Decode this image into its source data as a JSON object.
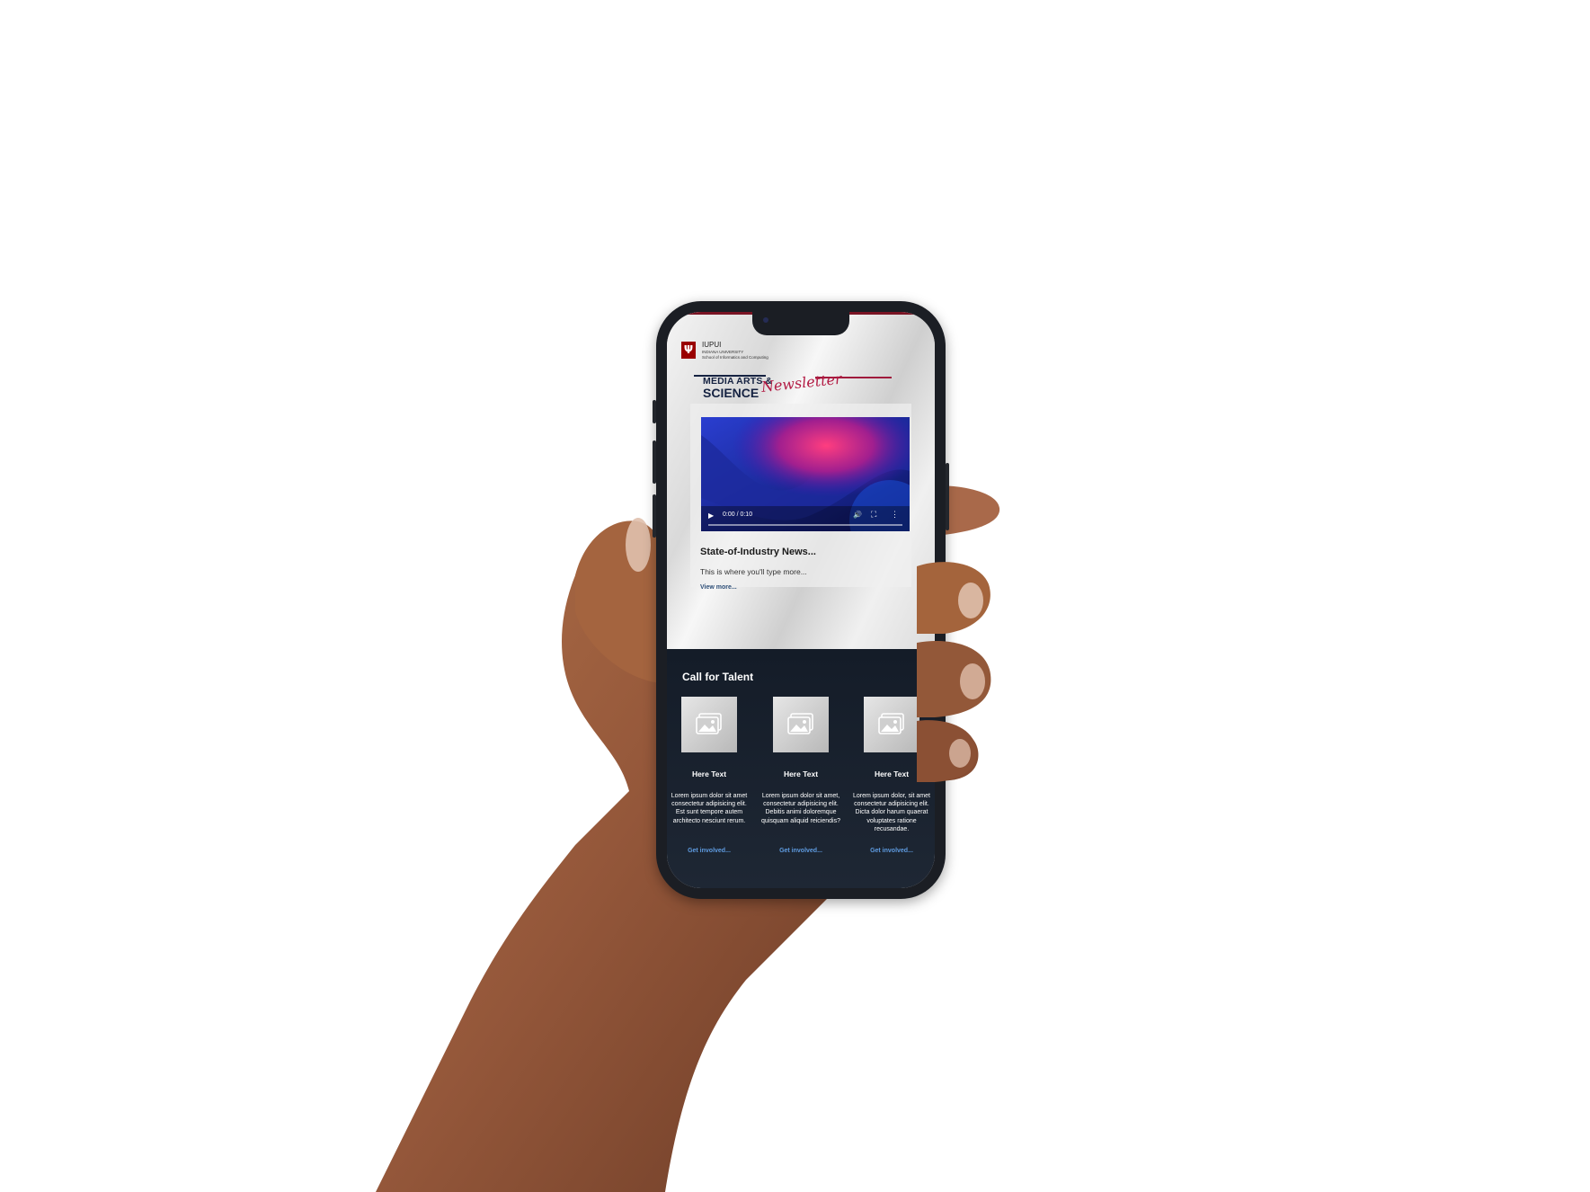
{
  "logo": {
    "mark": "Ψ",
    "line1": "IUPUI",
    "line2": "INDIANA UNIVERSITY",
    "line3": "School of Informatics and Computing"
  },
  "masthead": {
    "line1": "MEDIA ARTS &",
    "line2": "SCIENCE",
    "script": "Newsletter"
  },
  "video": {
    "time": "0:00 / 0:10",
    "progress": 0
  },
  "news": {
    "title": "State-of-Industry News...",
    "body": "This is where you'll type more...",
    "link": "View more..."
  },
  "talent": {
    "title": "Call for Talent",
    "items": [
      {
        "heading": "Here Text",
        "body": "Lorem ipsum dolor sit amet consectetur adipisicing elit. Est sunt tempore autem architecto nesciunt rerum.",
        "link": "Get involved..."
      },
      {
        "heading": "Here Text",
        "body": "Lorem ipsum dolor sit amet, consectetur adipisicing elit. Debitis animi doloremque quisquam aliquid reiciendis?",
        "link": "Get involved..."
      },
      {
        "heading": "Here Text",
        "body": "Lorem ipsum dolor, sit amet consectetur adipisicing elit. Dicta dolor harum quaerat voluptates ratione recusandae.",
        "link": "Get involved..."
      }
    ]
  },
  "colors": {
    "brand_red": "#990000",
    "accent_pink": "#b31b44",
    "navy": "#152241",
    "dark_section": "#141c28",
    "link_blue": "#5e9be0",
    "skin": "#9b5f3c"
  }
}
